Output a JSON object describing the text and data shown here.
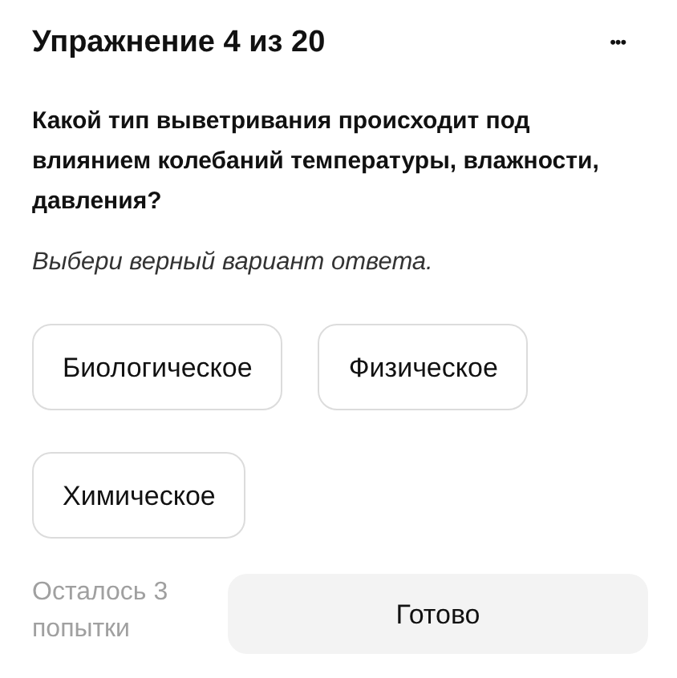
{
  "header": {
    "title": "Упражнение 4 из 20",
    "menu": "•••"
  },
  "question": "Какой тип выветривания происходит под влиянием колебаний температуры, влажности, давления?",
  "instruction": "Выбери верный вариант ответа.",
  "options": [
    {
      "label": "Биологическое",
      "selected": false
    },
    {
      "label": "Физическое",
      "selected": false
    },
    {
      "label": "Химическое",
      "selected": false
    }
  ],
  "footer": {
    "attempts": "Осталось 3 попытки",
    "submit": "Готово"
  }
}
